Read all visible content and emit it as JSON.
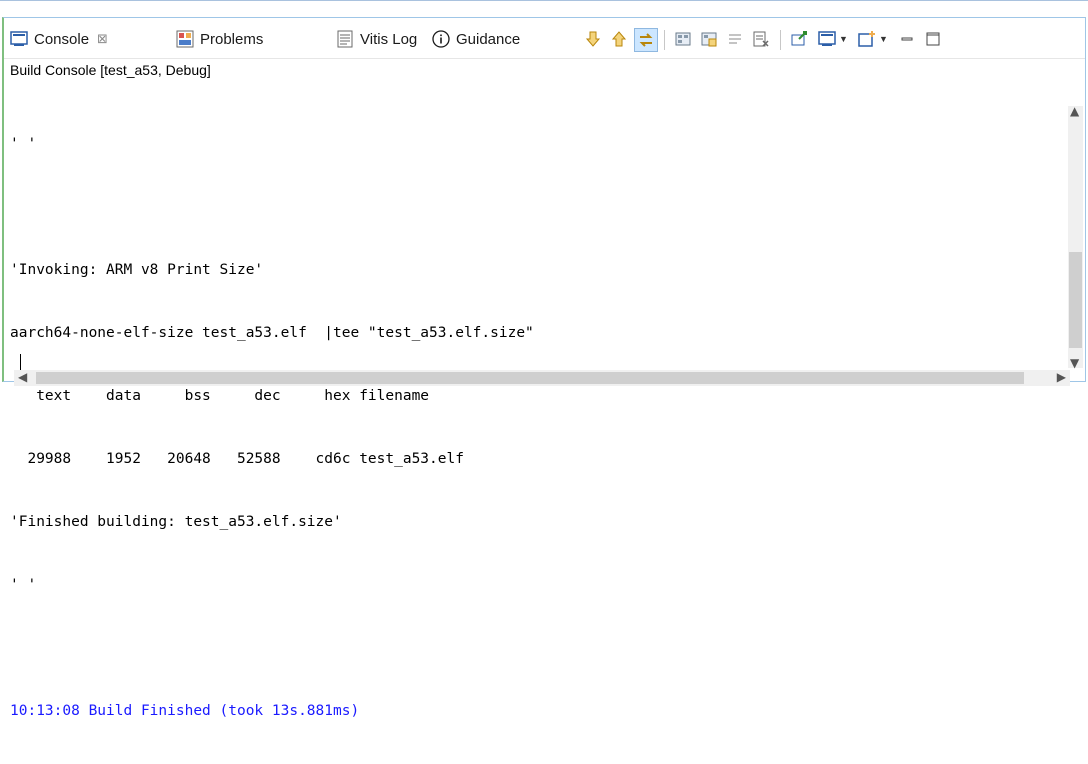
{
  "tabs": [
    {
      "label": "Console",
      "closable": true,
      "icon": "console-icon"
    },
    {
      "label": "Problems",
      "icon": "problems-icon"
    },
    {
      "label": "Vitis Log",
      "icon": "log-icon"
    },
    {
      "label": "Guidance",
      "icon": "info-icon"
    }
  ],
  "toolbar": {
    "icons": [
      "scroll-down-icon",
      "scroll-up-icon",
      "link-icon",
      "clear-console-icon",
      "lock-icon",
      "word-wrap-icon",
      "remove-icon",
      "pin-icon",
      "display-console-icon",
      "new-console-icon",
      "minimize-icon",
      "maximize-icon"
    ]
  },
  "console": {
    "title": "Build Console [test_a53, Debug]",
    "lines": [
      {
        "text": "' '",
        "color": "default"
      },
      {
        "text": "",
        "color": "default"
      },
      {
        "text": "'Invoking: ARM v8 Print Size'",
        "color": "default"
      },
      {
        "text": "aarch64-none-elf-size test_a53.elf  |tee \"test_a53.elf.size\"",
        "color": "default"
      },
      {
        "text": "   text    data     bss     dec     hex filename",
        "color": "default"
      },
      {
        "text": "  29988    1952   20648   52588    cd6c test_a53.elf",
        "color": "default"
      },
      {
        "text": "'Finished building: test_a53.elf.size'",
        "color": "default"
      },
      {
        "text": "' '",
        "color": "default"
      },
      {
        "text": "",
        "color": "default"
      },
      {
        "text": "10:13:08 Build Finished (took 13s.881ms)",
        "color": "blue"
      }
    ]
  },
  "colors": {
    "accent_border": "#7fbf7f",
    "info_blue": "#1a1aff",
    "selection": "#cce6ff"
  }
}
